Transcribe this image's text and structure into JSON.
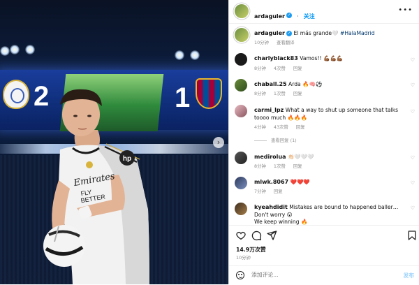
{
  "photo": {
    "home_score": "2",
    "away_score": "1",
    "shirt_sponsor": "Emirates\nFLY\nBETTER",
    "sleeve_logo": "hp"
  },
  "header": {
    "username": "ardaguler",
    "follow_label": "关注",
    "more_label": "•••"
  },
  "caption": {
    "username": "ardaguler",
    "text": "El más grande🤍",
    "hashtag": "#HalaMadrid",
    "time": "10分钟",
    "translate": "查看翻译"
  },
  "comments": [
    {
      "username": "charlyblack83",
      "text": "Vamos!! 💪🏾💪🏾💪🏾",
      "time": "8分钟",
      "likes": "4次赞",
      "reply": "回复"
    },
    {
      "username": "chaball.25",
      "text": "Arda 🔥🧠⚽",
      "time": "8分钟",
      "likes": "1次赞",
      "reply": "回复"
    },
    {
      "username": "carmi_lpz",
      "text": "What a way to shut up someone that talks toooo much 🔥🔥🔥",
      "time": "4分钟",
      "likes": "43次赞",
      "reply": "回复",
      "view_replies": "查看回复 (1)"
    },
    {
      "username": "medirolua",
      "text": "👏🏻🤍🤍🤍",
      "time": "8分钟",
      "likes": "1次赞",
      "reply": "回复"
    },
    {
      "username": "mlwk.8067",
      "text": "❤️❤️❤️",
      "time": "7分钟",
      "likes": "",
      "reply": "回复"
    },
    {
      "username": "kyeahdidit",
      "text": "Mistakes are bound to happened baller… Don't worry 😮",
      "text2": "We keep winning 🔥",
      "time": "",
      "likes": "",
      "reply": ""
    }
  ],
  "footer": {
    "likes": "14.9万次赞",
    "time": "10分钟",
    "comment_placeholder": "添加评论...",
    "post_label": "发布"
  },
  "icons": {
    "heart": "heart-icon",
    "comment": "comment-icon",
    "share": "share-icon",
    "save": "bookmark-icon",
    "emoji": "emoji-icon"
  },
  "colors": {
    "follow_blue": "#0095f6",
    "verified_blue": "#1d9bf0",
    "post_disabled": "#9fd3fb",
    "meta_gray": "#8e8e8e"
  }
}
